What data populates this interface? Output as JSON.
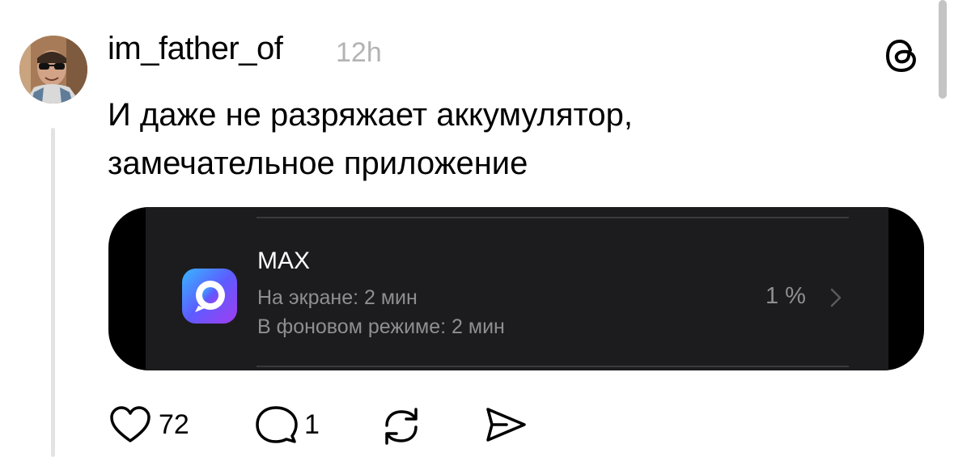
{
  "post": {
    "username": "im_father_of",
    "timestamp": "12h",
    "text": "И даже не разряжает аккумулятор,\nзамечательное приложение",
    "avatar_icon": "profile-photo-icon",
    "platform_icon": "threads-logo-icon"
  },
  "media": {
    "app_name": "MAX",
    "on_screen": "На экране: 2 мин",
    "background": "В фоновом режиме: 2 мин",
    "percent": "1 %",
    "app_icon": "max-app-icon",
    "chevron_icon": "chevron-right-icon"
  },
  "actions": {
    "likes": "72",
    "replies": "1",
    "like_icon": "heart-icon",
    "reply_icon": "comment-icon",
    "repost_icon": "repost-icon",
    "share_icon": "send-icon"
  },
  "colors": {
    "text": "#000000",
    "muted": "#b3b3b3",
    "card_bg": "#1c1c1e",
    "card_text_muted": "#8e8e93"
  }
}
